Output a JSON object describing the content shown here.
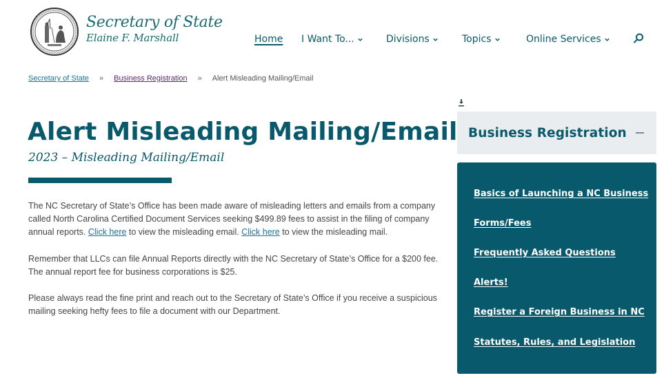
{
  "header": {
    "brand_title": "Secretary of State",
    "brand_subtitle": "Elaine F. Marshall",
    "logo": "nc-state-seal"
  },
  "nav": {
    "items": [
      {
        "label": "Home",
        "active": true,
        "dropdown": false
      },
      {
        "label": "I Want To...",
        "active": false,
        "dropdown": true
      },
      {
        "label": "Divisions",
        "active": false,
        "dropdown": true
      },
      {
        "label": "Topics",
        "active": false,
        "dropdown": true
      },
      {
        "label": "Online Services",
        "active": false,
        "dropdown": true
      }
    ],
    "search_icon": "search-icon"
  },
  "breadcrumb": {
    "items": [
      "Secretary of State",
      "Business Registration"
    ],
    "separator": "»",
    "current": "Alert Misleading Mailing/Email"
  },
  "main": {
    "title": "Alert Misleading Mailing/Email",
    "subtitle": "2023 – Misleading Mailing/Email",
    "paragraphs": {
      "p1_a": "The NC Secretary of State’s Office has been made aware of misleading letters and emails from a company called North Carolina Certified Document Services seeking $499.89 fees to assist in the filing of company annual reports. ",
      "p1_link1": "Click here",
      "p1_b": " to view the misleading email. ",
      "p1_link2": "Click here",
      "p1_c": " to view the misleading mail.",
      "p2": "Remember that LLCs can file Annual Reports directly with the NC Secretary of State’s Office for a $200 fee. The annual report fee for business corporations is $25.",
      "p3": "Please always read the fine print and reach out to the Secretary of State’s Office if you receive a suspicious mailing seeking hefty fees to file a document with our Department."
    }
  },
  "sidebar": {
    "download_icon": "download-icon",
    "header": "Business Registration",
    "collapse_icon": "minus-icon",
    "links": [
      "Basics of Launching a NC Business",
      "Forms/Fees",
      "Frequently Asked Questions",
      "Alerts!",
      "Register a Foreign Business in NC",
      "Statutes, Rules, and Legislation"
    ]
  },
  "colors": {
    "brand_teal": "#07596b",
    "sidebar_header_bg": "#eaedf0",
    "link_blue": "#1f6f9b",
    "link_visited": "#5a2a6a",
    "body_text": "#444444"
  }
}
